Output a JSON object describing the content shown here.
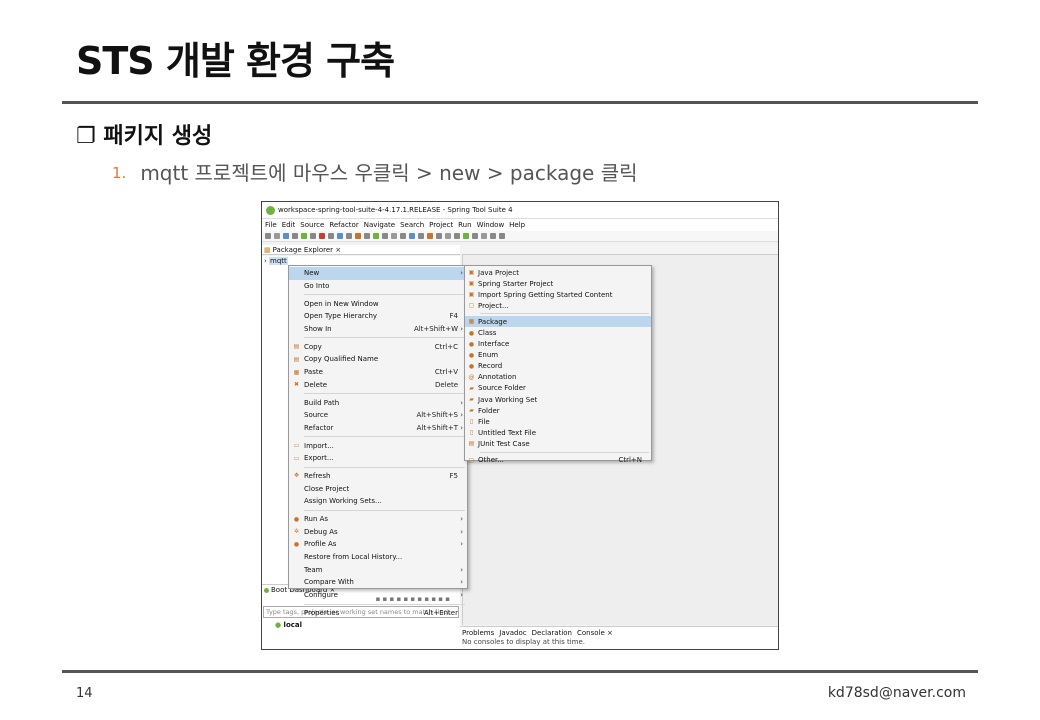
{
  "slide": {
    "title": "STS 개발 환경 구축",
    "section": "❐ 패키지 생성",
    "step_num": "1.",
    "step_text": "mqtt 프로젝트에 마우스 우클릭 > new > package 클릭",
    "page_number": "14",
    "email": "kd78sd@naver.com"
  },
  "eclipse": {
    "window_title": "workspace-spring-tool-suite-4-4.17.1.RELEASE - Spring Tool Suite 4",
    "menus": [
      "File",
      "Edit",
      "Source",
      "Refactor",
      "Navigate",
      "Search",
      "Project",
      "Run",
      "Window",
      "Help"
    ],
    "package_explorer_title": "Package Explorer ×",
    "project_name": "mqtt",
    "context_menu": [
      {
        "label": "New",
        "shortcut": "",
        "arrow": "›",
        "icon": "",
        "highlight": true
      },
      {
        "label": "Go Into",
        "shortcut": "",
        "arrow": "",
        "icon": ""
      },
      {
        "sep": true
      },
      {
        "label": "Open in New Window",
        "shortcut": "",
        "arrow": "",
        "icon": ""
      },
      {
        "label": "Open Type Hierarchy",
        "shortcut": "F4",
        "arrow": "",
        "icon": ""
      },
      {
        "label": "Show In",
        "shortcut": "Alt+Shift+W",
        "arrow": "›",
        "icon": ""
      },
      {
        "sep": true
      },
      {
        "label": "Copy",
        "shortcut": "Ctrl+C",
        "arrow": "",
        "icon": "▤"
      },
      {
        "label": "Copy Qualified Name",
        "shortcut": "",
        "arrow": "",
        "icon": "▤"
      },
      {
        "label": "Paste",
        "shortcut": "Ctrl+V",
        "arrow": "",
        "icon": "▦"
      },
      {
        "label": "Delete",
        "shortcut": "Delete",
        "arrow": "",
        "icon": "✖"
      },
      {
        "sep": true
      },
      {
        "label": "Build Path",
        "shortcut": "",
        "arrow": "›",
        "icon": ""
      },
      {
        "label": "Source",
        "shortcut": "Alt+Shift+S",
        "arrow": "›",
        "icon": ""
      },
      {
        "label": "Refactor",
        "shortcut": "Alt+Shift+T",
        "arrow": "›",
        "icon": ""
      },
      {
        "sep": true
      },
      {
        "label": "Import...",
        "shortcut": "",
        "arrow": "",
        "icon": "▭"
      },
      {
        "label": "Export...",
        "shortcut": "",
        "arrow": "",
        "icon": "▭"
      },
      {
        "sep": true
      },
      {
        "label": "Refresh",
        "shortcut": "F5",
        "arrow": "",
        "icon": "✥"
      },
      {
        "label": "Close Project",
        "shortcut": "",
        "arrow": "",
        "icon": ""
      },
      {
        "label": "Assign Working Sets...",
        "shortcut": "",
        "arrow": "",
        "icon": ""
      },
      {
        "sep": true
      },
      {
        "label": "Run As",
        "shortcut": "",
        "arrow": "›",
        "icon": "●"
      },
      {
        "label": "Debug As",
        "shortcut": "",
        "arrow": "›",
        "icon": "✲"
      },
      {
        "label": "Profile As",
        "shortcut": "",
        "arrow": "›",
        "icon": "●"
      },
      {
        "label": "Restore from Local History...",
        "shortcut": "",
        "arrow": "",
        "icon": ""
      },
      {
        "label": "Team",
        "shortcut": "",
        "arrow": "›",
        "icon": ""
      },
      {
        "label": "Compare With",
        "shortcut": "",
        "arrow": "›",
        "icon": ""
      },
      {
        "label": "Configure",
        "shortcut": "",
        "arrow": "›",
        "icon": ""
      },
      {
        "sep": true
      },
      {
        "label": "Properties",
        "shortcut": "Alt+Enter",
        "arrow": "",
        "icon": ""
      }
    ],
    "new_submenu": [
      {
        "label": "Java Project",
        "shortcut": "",
        "icon": "▣"
      },
      {
        "label": "Spring Starter Project",
        "shortcut": "",
        "icon": "▣"
      },
      {
        "label": "Import Spring Getting Started Content",
        "shortcut": "",
        "icon": "▣"
      },
      {
        "label": "Project...",
        "shortcut": "",
        "icon": "▢"
      },
      {
        "sep": true
      },
      {
        "label": "Package",
        "shortcut": "",
        "icon": "▦",
        "highlight": true
      },
      {
        "label": "Class",
        "shortcut": "",
        "icon": "●"
      },
      {
        "label": "Interface",
        "shortcut": "",
        "icon": "●"
      },
      {
        "label": "Enum",
        "shortcut": "",
        "icon": "●"
      },
      {
        "label": "Record",
        "shortcut": "",
        "icon": "●"
      },
      {
        "label": "Annotation",
        "shortcut": "",
        "icon": "@"
      },
      {
        "label": "Source Folder",
        "shortcut": "",
        "icon": "▰"
      },
      {
        "label": "Java Working Set",
        "shortcut": "",
        "icon": "▰"
      },
      {
        "label": "Folder",
        "shortcut": "",
        "icon": "▰"
      },
      {
        "label": "File",
        "shortcut": "",
        "icon": "▯"
      },
      {
        "label": "Untitled Text File",
        "shortcut": "",
        "icon": "▯"
      },
      {
        "label": "JUnit Test Case",
        "shortcut": "",
        "icon": "▤"
      },
      {
        "sep": true
      },
      {
        "label": "Other...",
        "shortcut": "Ctrl+N",
        "icon": "▢"
      }
    ],
    "boot_dashboard_title": "Boot Dashboard ×",
    "boot_filter_placeholder": "Type tags, projects, or working set names to match (incl.",
    "boot_local": "local",
    "console_tabs": [
      "Problems",
      "Javadoc",
      "Declaration",
      "Console ×"
    ],
    "console_message": "No consoles to display at this time."
  },
  "colors": {
    "step_number": "#e07a3c",
    "menu_highlight": "#bcd6ee",
    "spring_green": "#6db33f"
  }
}
